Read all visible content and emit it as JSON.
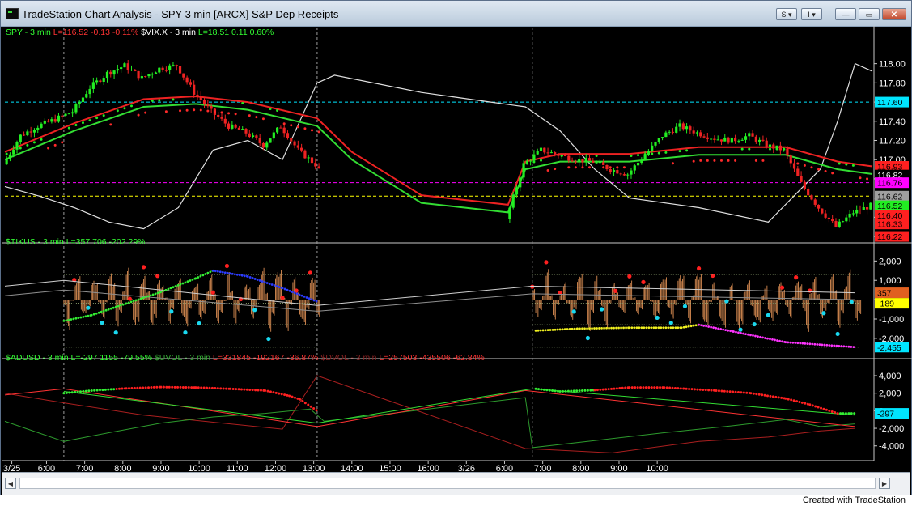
{
  "window": {
    "title": "TradeStation Chart Analysis - SPY 3 min [ARCX] S&P Dep Receipts",
    "buttons": {
      "s_label": "S ▾",
      "i_label": "I ▾",
      "minimize": "—",
      "maximize": "▭",
      "close": "✕"
    }
  },
  "footer": {
    "created_with": "Created with TradeStation"
  },
  "colors": {
    "background": "#000000",
    "up_bar": "#22ee22",
    "down_bar": "#ee2222",
    "axis": "#ffffff",
    "cyan": "#00e5ff",
    "magenta": "#ff00ff",
    "yellow": "#ffff00",
    "orange_hist": "#d98c52"
  },
  "chart_data": [
    {
      "name": "price-panel",
      "type": "candlestick",
      "symbol": "SPY",
      "interval": "3 min",
      "legend": [
        {
          "text": "SPY - 3 min",
          "color": "#33ff33"
        },
        {
          "text": "L=116.52",
          "color": "#ff3333"
        },
        {
          "text": "-0.13",
          "color": "#ff3333"
        },
        {
          "text": "-0.11%",
          "color": "#ff3333"
        },
        {
          "text": "$VIX.X - 3 min",
          "color": "#ffffff"
        },
        {
          "text": "L=18.51",
          "color": "#33ff33"
        },
        {
          "text": "0.11",
          "color": "#33ff33"
        },
        {
          "text": "0.60%",
          "color": "#33ff33"
        }
      ],
      "ylim": [
        116.15,
        118.25
      ],
      "yticks": [
        "118.00",
        "117.80",
        "117.60",
        "117.40",
        "117.20",
        "117.00",
        "116.80",
        "116.60",
        "116.40",
        "116.20"
      ],
      "price_path": [
        [
          0,
          116.95
        ],
        [
          5,
          117.25
        ],
        [
          10,
          117.35
        ],
        [
          15,
          117.42
        ],
        [
          20,
          117.5
        ],
        [
          25,
          117.75
        ],
        [
          30,
          117.9
        ],
        [
          35,
          117.98
        ],
        [
          40,
          117.85
        ],
        [
          45,
          117.95
        ],
        [
          50,
          117.98
        ],
        [
          55,
          117.7
        ],
        [
          60,
          117.5
        ],
        [
          65,
          117.35
        ],
        [
          70,
          117.28
        ],
        [
          75,
          117.15
        ],
        [
          80,
          117.35
        ],
        [
          85,
          117.1
        ],
        [
          90,
          116.95
        ],
        [
          95,
          116.7
        ],
        [
          100,
          116.6
        ],
        [
          105,
          116.5
        ],
        [
          110,
          116.45
        ],
        [
          115,
          116.38
        ],
        [
          120,
          116.37
        ],
        [
          125,
          116.38
        ],
        [
          130,
          116.4
        ],
        [
          135,
          116.42
        ],
        [
          140,
          116.43
        ],
        [
          145,
          116.38
        ],
        [
          150,
          116.95
        ],
        [
          155,
          117.1
        ],
        [
          160,
          117.05
        ],
        [
          165,
          117.0
        ],
        [
          170,
          116.98
        ],
        [
          175,
          116.9
        ],
        [
          180,
          116.85
        ],
        [
          185,
          117.05
        ],
        [
          190,
          117.25
        ],
        [
          195,
          117.35
        ],
        [
          200,
          117.28
        ],
        [
          205,
          117.22
        ],
        [
          210,
          117.2
        ],
        [
          215,
          117.25
        ],
        [
          220,
          117.15
        ],
        [
          225,
          117.1
        ],
        [
          230,
          116.75
        ],
        [
          235,
          116.5
        ],
        [
          240,
          116.3
        ],
        [
          245,
          116.45
        ],
        [
          250,
          116.52
        ]
      ],
      "moving_average_path": [
        [
          0,
          117.0
        ],
        [
          20,
          117.3
        ],
        [
          40,
          117.55
        ],
        [
          55,
          117.58
        ],
        [
          70,
          117.52
        ],
        [
          90,
          117.35
        ],
        [
          100,
          117.0
        ],
        [
          120,
          116.55
        ],
        [
          145,
          116.45
        ],
        [
          150,
          116.9
        ],
        [
          160,
          116.98
        ],
        [
          180,
          116.98
        ],
        [
          200,
          117.05
        ],
        [
          225,
          117.05
        ],
        [
          240,
          116.9
        ],
        [
          250,
          116.85
        ]
      ],
      "vix_path": [
        [
          0,
          116.72
        ],
        [
          10,
          116.62
        ],
        [
          20,
          116.5
        ],
        [
          30,
          116.35
        ],
        [
          40,
          116.28
        ],
        [
          50,
          116.5
        ],
        [
          60,
          117.1
        ],
        [
          70,
          117.2
        ],
        [
          80,
          117.0
        ],
        [
          90,
          117.8
        ],
        [
          95,
          117.88
        ],
        [
          120,
          117.7
        ],
        [
          130,
          117.65
        ],
        [
          140,
          117.6
        ],
        [
          150,
          117.55
        ],
        [
          160,
          117.3
        ],
        [
          170,
          116.9
        ],
        [
          180,
          116.6
        ],
        [
          200,
          116.5
        ],
        [
          220,
          116.35
        ],
        [
          235,
          116.9
        ],
        [
          240,
          117.4
        ],
        [
          245,
          118.0
        ],
        [
          250,
          117.92
        ]
      ],
      "reference_lines": [
        {
          "value": 117.6,
          "color": "#00e5ff",
          "style": "dash"
        },
        {
          "value": 116.76,
          "color": "#ff00ff",
          "style": "dash"
        },
        {
          "value": 116.62,
          "color": "#ffff00",
          "style": "dash"
        }
      ],
      "price_labels": [
        {
          "text": "117.60",
          "value": 117.6,
          "bg": "#00e5ff",
          "fg": "#000000"
        },
        {
          "text": "116.93",
          "value": 116.93,
          "bg": "#ff2020",
          "fg": "#000000"
        },
        {
          "text": "116.82",
          "value": 116.84,
          "bg": "#000000",
          "fg": "#ffffff"
        },
        {
          "text": "116.76",
          "value": 116.76,
          "bg": "#ff00ff",
          "fg": "#000000"
        },
        {
          "text": "116.62",
          "value": 116.62,
          "bg": "#a0a0a0",
          "fg": "#000000"
        },
        {
          "text": "116.52",
          "value": 116.52,
          "bg": "#22ee22",
          "fg": "#000000"
        },
        {
          "text": "116.40",
          "value": 116.42,
          "bg": "#ff2020",
          "fg": "#000000"
        },
        {
          "text": "116.33",
          "value": 116.33,
          "bg": "#ff2020",
          "fg": "#000000"
        },
        {
          "text": "116.22",
          "value": 116.2,
          "bg": "#ff2020",
          "fg": "#000000"
        }
      ]
    },
    {
      "name": "tikus-panel",
      "type": "histogram",
      "legend": [
        {
          "text": "$TIKUS - 3 min",
          "color": "#33ff33"
        },
        {
          "text": "L=357",
          "color": "#33ff33"
        },
        {
          "text": "706",
          "color": "#33ff33"
        },
        {
          "text": "-202.29%",
          "color": "#33ff33"
        }
      ],
      "ylim": [
        -2800,
        2600
      ],
      "yticks": [
        "2,000",
        "1,000",
        "0",
        "-1,000",
        "-2,000"
      ],
      "reference_lines": [
        {
          "value": 1300,
          "color": "#9ab07a",
          "style": "dot"
        },
        {
          "value": -189,
          "color": "#9ab07a",
          "style": "dot"
        },
        {
          "value": -1300,
          "color": "#9ab07a",
          "style": "dot"
        },
        {
          "value": -2455,
          "color": "#9ab07a",
          "style": "dot"
        }
      ],
      "trend_path": [
        [
          17,
          -1100
        ],
        [
          25,
          -800
        ],
        [
          35,
          -200
        ],
        [
          45,
          400
        ],
        [
          55,
          1100
        ],
        [
          60,
          1500
        ],
        [
          70,
          1200
        ],
        [
          80,
          600
        ],
        [
          90,
          -100
        ],
        [
          153,
          -1600
        ],
        [
          165,
          -1500
        ],
        [
          180,
          -1450
        ],
        [
          195,
          -1450
        ],
        [
          200,
          -1300
        ],
        [
          210,
          -1650
        ],
        [
          225,
          -2200
        ],
        [
          245,
          -2455
        ]
      ],
      "price_labels": [
        {
          "text": "357",
          "value": 357,
          "bg": "#e06020",
          "fg": "#000000"
        },
        {
          "text": "-189",
          "value": -189,
          "bg": "#ffff00",
          "fg": "#000000"
        },
        {
          "text": "-2,455",
          "value": -2455,
          "bg": "#00e5ff",
          "fg": "#000000"
        }
      ]
    },
    {
      "name": "breadth-panel",
      "type": "line",
      "legend": [
        {
          "text": "$ADUSD - 3 min",
          "color": "#33ff33"
        },
        {
          "text": "L=-297",
          "color": "#33ff33"
        },
        {
          "text": "1155",
          "color": "#33ff33"
        },
        {
          "text": "-79.55%",
          "color": "#33ff33"
        },
        {
          "text": "$UVOL - 3 min",
          "color": "#33aa33"
        },
        {
          "text": "L=331845",
          "color": "#ff3333"
        },
        {
          "text": "-192167",
          "color": "#ff3333"
        },
        {
          "text": "-36.87%",
          "color": "#ff3333"
        },
        {
          "text": "$DVOL - 3 min",
          "color": "#882222"
        },
        {
          "text": "L=257503",
          "color": "#ff3333"
        },
        {
          "text": "-435506",
          "color": "#ff3333"
        },
        {
          "text": "-62.84%",
          "color": "#ff3333"
        }
      ],
      "ylim": [
        -5500,
        5200
      ],
      "yticks": [
        "4,000",
        "2,000",
        "0",
        "-2,000",
        "-4,000"
      ],
      "adusd_path": [
        [
          17,
          2000
        ],
        [
          25,
          2300
        ],
        [
          35,
          2550
        ],
        [
          45,
          2700
        ],
        [
          55,
          2650
        ],
        [
          65,
          2500
        ],
        [
          75,
          2300
        ],
        [
          82,
          1700
        ],
        [
          85,
          1300
        ],
        [
          90,
          0
        ],
        [
          153,
          2500
        ],
        [
          160,
          2200
        ],
        [
          170,
          2350
        ],
        [
          180,
          2650
        ],
        [
          190,
          2650
        ],
        [
          205,
          2300
        ],
        [
          215,
          2000
        ],
        [
          225,
          1400
        ],
        [
          232,
          700
        ],
        [
          240,
          -300
        ],
        [
          245,
          -297
        ]
      ],
      "uvol_path": [
        [
          0,
          -1200
        ],
        [
          17,
          -3500
        ],
        [
          30,
          -2500
        ],
        [
          45,
          -1400
        ],
        [
          60,
          -700
        ],
        [
          75,
          -300
        ],
        [
          88,
          200
        ],
        [
          92,
          -1200
        ],
        [
          150,
          1500
        ],
        [
          152,
          -4200
        ],
        [
          170,
          -3400
        ],
        [
          190,
          -2500
        ],
        [
          210,
          -1700
        ],
        [
          225,
          -1000
        ],
        [
          235,
          -1800
        ],
        [
          245,
          -1500
        ]
      ],
      "dvol_path": [
        [
          0,
          2000
        ],
        [
          17,
          900
        ],
        [
          40,
          -500
        ],
        [
          60,
          -1300
        ],
        [
          80,
          -2100
        ],
        [
          90,
          4000
        ],
        [
          150,
          -4300
        ],
        [
          175,
          -4800
        ],
        [
          200,
          -3500
        ],
        [
          220,
          -3000
        ],
        [
          235,
          -2300
        ],
        [
          245,
          -2000
        ]
      ],
      "price_labels": [
        {
          "text": "-297",
          "value": -297,
          "bg": "#00e5ff",
          "fg": "#000000"
        }
      ]
    }
  ],
  "time_axis": {
    "bars_total": 250,
    "session_breaks": [
      17,
      90,
      152
    ],
    "labels": [
      {
        "text": "3/25",
        "bar": 2
      },
      {
        "text": "6:00",
        "bar": 12
      },
      {
        "text": "7:00",
        "bar": 23
      },
      {
        "text": "8:00",
        "bar": 34
      },
      {
        "text": "9:00",
        "bar": 45
      },
      {
        "text": "10:00",
        "bar": 56
      },
      {
        "text": "11:00",
        "bar": 67
      },
      {
        "text": "12:00",
        "bar": 78
      },
      {
        "text": "13:00",
        "bar": 89
      },
      {
        "text": "14:00",
        "bar": 100
      },
      {
        "text": "15:00",
        "bar": 111
      },
      {
        "text": "16:00",
        "bar": 122
      },
      {
        "text": "3/26",
        "bar": 133
      },
      {
        "text": "6:00",
        "bar": 144
      },
      {
        "text": "7:00",
        "bar": 155
      },
      {
        "text": "8:00",
        "bar": 166
      },
      {
        "text": "9:00",
        "bar": 177
      },
      {
        "text": "10:00",
        "bar": 188
      }
    ]
  }
}
